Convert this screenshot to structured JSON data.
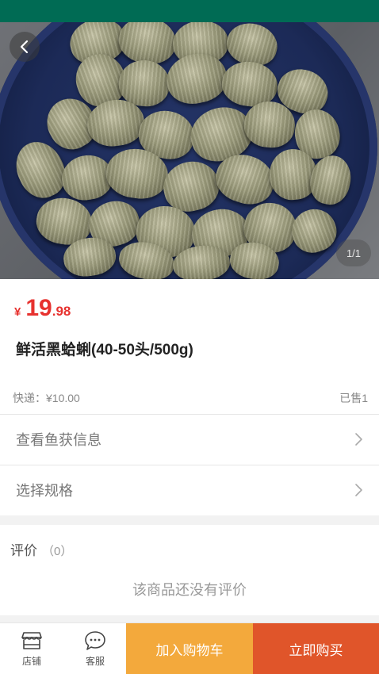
{
  "colors": {
    "status_bar": "#006b54",
    "price": "#e7322f",
    "cart_button": "#f3a93c",
    "buy_button": "#e0552a"
  },
  "hero": {
    "image_description": "clams",
    "back_icon": "chevron-left-icon",
    "pager": "1/1"
  },
  "product": {
    "currency": "¥",
    "price_integer": "19",
    "price_decimal": ".98",
    "title": "鲜活黑蛤蜊(40-50头/500g)",
    "shipping": "快递：¥10.00",
    "sold": "已售1"
  },
  "links": {
    "catch_info": "查看鱼获信息",
    "choose_spec": "选择规格"
  },
  "reviews": {
    "title": "评价",
    "count": "（0）",
    "empty_text": "该商品还没有评价"
  },
  "bottom_bar": {
    "store_label": "店铺",
    "service_label": "客服",
    "add_to_cart": "加入购物车",
    "buy_now": "立即购买"
  }
}
